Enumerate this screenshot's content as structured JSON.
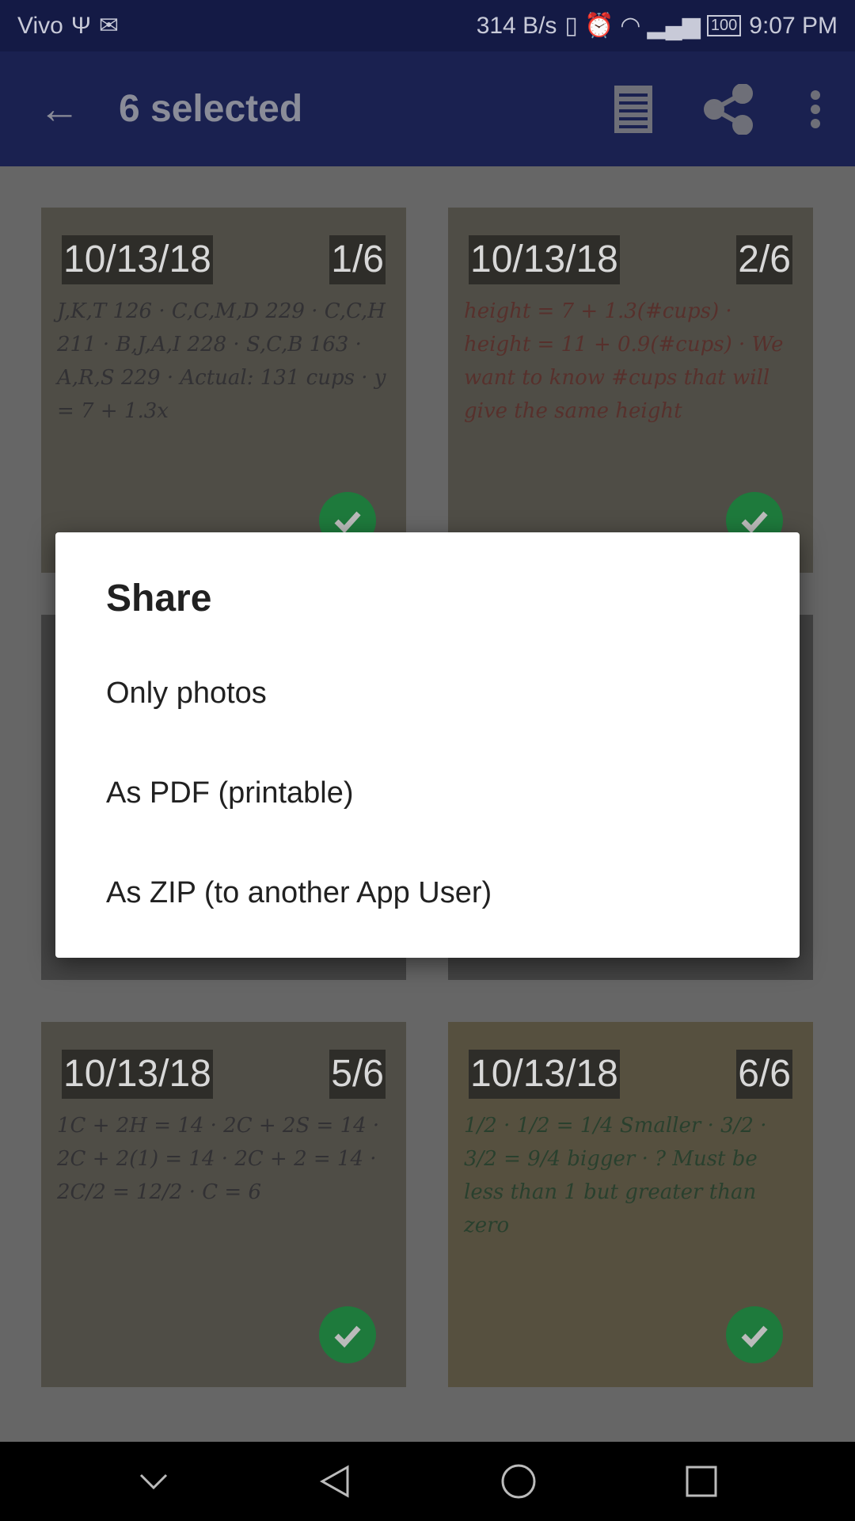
{
  "status_bar": {
    "carrier": "Vivo",
    "speed": "314 B/s",
    "battery": "100",
    "time": "9:07 PM"
  },
  "toolbar": {
    "title": "6 selected",
    "icons": [
      "back-arrow-icon",
      "list-icon",
      "share-icon",
      "more-vert-icon"
    ]
  },
  "tiles": [
    {
      "date": "10/13/18",
      "index": "1/6",
      "selected": true,
      "text": "J,K,T 126 · C,C,M,D 229 · C,C,H 211 · B,J,A,I 228 · S,C,B 163 · A,R,S 229 · Actual: 131 cups · y = 7 + 1.3x"
    },
    {
      "date": "10/13/18",
      "index": "2/6",
      "selected": true,
      "text": "height = 7 + 1.3(#cups) · height = 11 + 0.9(#cups) · We want to know #cups that will give the same height"
    },
    {
      "date": "",
      "index": "",
      "selected": true,
      "text": ""
    },
    {
      "date": "",
      "index": "",
      "selected": true,
      "text": ""
    },
    {
      "date": "10/13/18",
      "index": "5/6",
      "selected": true,
      "text": "1C + 2H = 14 · 2C + 2S = 14 · 2C + 2(1) = 14 · 2C + 2 = 14 · 2C/2 = 12/2 · C = 6"
    },
    {
      "date": "10/13/18",
      "index": "6/6",
      "selected": true,
      "text": "1/2 · 1/2 = 1/4 Smaller · 3/2 · 3/2 = 9/4 bigger · ? Must be less than 1 but greater than zero"
    }
  ],
  "dialog": {
    "title": "Share",
    "options": [
      "Only photos",
      "As PDF (printable)",
      "As ZIP (to another App User)"
    ]
  },
  "nav_bar": {
    "icons": [
      "chevron-down-icon",
      "back-triangle-icon",
      "home-circle-icon",
      "recents-square-icon"
    ]
  }
}
